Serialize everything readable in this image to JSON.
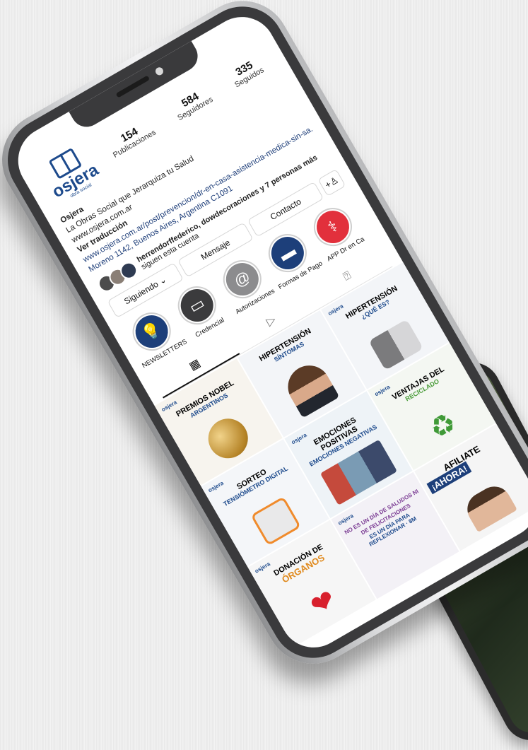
{
  "profile": {
    "logo_text": "osjera",
    "logo_sub": "obra social",
    "stats": [
      {
        "value": "154",
        "label": "Publicaciones"
      },
      {
        "value": "584",
        "label": "Seguidores"
      },
      {
        "value": "335",
        "label": "Seguidos"
      }
    ],
    "name": "Osjera",
    "bio_line1": "La Obras Social que Jerarquiza tu Salud",
    "website": "www.osjera.com.ar",
    "translate": "Ver traducción",
    "link": "www.osjera.com.ar/post/prevencion/dr-en-casa-asistencia-medica-sin-sa...",
    "address": "Moreno 1142, Buenos Aires, Argentina C1091"
  },
  "followers": {
    "names": "herrendorffederico, dowdecoraciones y 7 personas más",
    "suffix": "siguen esta cuenta"
  },
  "buttons": {
    "following": "Siguiendo ⌄",
    "message": "Mensaje",
    "contact": "Contacto",
    "add_icon": "+♙"
  },
  "highlights": [
    {
      "label": "NEWSLETTERS",
      "icon": "lightbulb-icon",
      "glyph": "💡",
      "color": "#1d3f7a"
    },
    {
      "label": "Credencial",
      "icon": "card-icon",
      "glyph": "▭",
      "color": "#3b3b3d"
    },
    {
      "label": "Autorizaciones",
      "icon": "at-icon",
      "glyph": "@",
      "color": "#8c8c8e"
    },
    {
      "label": "Formas de Pago",
      "icon": "payment-card-icon",
      "glyph": "▬",
      "color": "#1d3f7a"
    },
    {
      "label": "APP Dr en Ca",
      "icon": "medical-app-icon",
      "glyph": "⚕",
      "color": "#e2303c"
    }
  ],
  "tabs": {
    "grid_icon": "▦",
    "reels_icon": "▷",
    "tagged_icon": "⍰"
  },
  "posts": [
    {
      "brand": "osjera",
      "title": "PREMIOS NOBEL",
      "sub": "ARGENTINOS",
      "bg": "#f7f4ee",
      "art": "nobel-medal"
    },
    {
      "brand": "",
      "title": "HIPERTENSIÓN",
      "sub": "SÍNTOMAS",
      "bg": "#f3f5f8",
      "art": "woman-headache"
    },
    {
      "brand": "osjera",
      "title": "HIPERTENSIÓN",
      "sub": "¿QUÉ ES?",
      "bg": "#f3f5f8",
      "art": "blood-pressure-monitor"
    },
    {
      "brand": "osjera",
      "title": "SORTEO",
      "sub": "TENSIÓMETRO DIGITAL",
      "bg": "#f4f6f9",
      "art": "tensiometer"
    },
    {
      "brand": "osjera",
      "title": "EMOCIONES POSITIVAS",
      "sub": "EMOCIONES NEGATIVAS",
      "bg": "#eef3f7",
      "art": "couple-photo"
    },
    {
      "brand": "osjera",
      "title": "VENTAJAS DEL",
      "sub": "RECICLADO",
      "bg": "#f4f7f2",
      "art": "recycle-icon"
    },
    {
      "brand": "osjera",
      "title": "DONACIÓN DE",
      "sub": "ÓRGANOS",
      "bg": "#f6f6f6",
      "art": "heart-hands"
    },
    {
      "brand": "osjera",
      "title": "NO ES UN DÍA DE SALUDOS NI DE FELICITACIONES",
      "sub": "ES UN DÍA PARA REFLEXIONAR · 8M",
      "bg": "#f3f1f6",
      "art": "8m"
    },
    {
      "brand": "",
      "title": "AFILIATE",
      "sub": "¡AHORA!",
      "bg": "#f5f5f5",
      "art": "family-photo"
    }
  ]
}
